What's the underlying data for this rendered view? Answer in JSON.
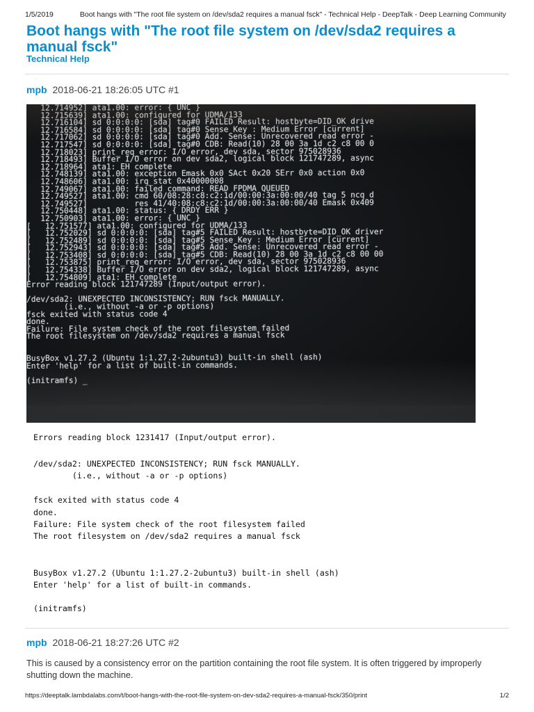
{
  "print_header": {
    "date": "1/5/2019",
    "page_title": "Boot hangs with \"The root file system on /dev/sda2 requires a manual fsck\" - Technical Help - DeepTalk - Deep Learning Community"
  },
  "topic": {
    "title": "Boot hangs with \"The root file system on /dev/sda2 requires a manual fsck\"",
    "category": "Technical Help"
  },
  "posts": [
    {
      "author": "mpb",
      "timestamp": "2018-06-21 18:26:05 UTC #1",
      "photo_console_lines": [
        "   12.714952] ata1.00: error: { UNC }",
        "   12.715639] ata1.00: configured for UDMA/133",
        "   12.716104] sd 0:0:0:0: [sda] tag#0 FAILED Result: hostbyte=DID_OK drive",
        "   12.716584] sd 0:0:0:0: [sda] tag#0 Sense Key : Medium Error [current]",
        "   12.717062] sd 0:0:0:0: [sda] tag#0 Add. Sense: Unrecovered read error -",
        "   12.717547] sd 0:0:0:0: [sda] tag#0 CDB: Read(10) 28 00 3a 1d c2 c8 00 0",
        "   12.718023] print_req_error: I/O error, dev sda, sector 975028936",
        "   12.718493] Buffer I/O error on dev sda2, logical block 121747289, async",
        "   12.718964] ata1: EH complete",
        "   12.748139] ata1.00: exception Emask 0x0 SAct 0x20 SErr 0x0 action 0x0",
        "   12.748606] ata1.00: irq_stat 0x40000008",
        "   12.749067] ata1.00: failed command: READ FPDMA QUEUED",
        "   12.749527] ata1.00: cmd 60/08:28:c8:c2:1d/00:00:3a:00:00/40 tag 5 ncq d",
        "   12.749527]          res 41/40:08:c8:c2:1d/00:00:3a:00:00/40 Emask 0x409",
        "   12.750448] ata1.00: status: { DRDY ERR }",
        "   12.750903] ata1.00: error: { UNC }",
        "[   12.751577] ata1.00: configured for UDMA/133",
        "[   12.752029] sd 0:0:0:0: [sda] tag#5 FAILED Result: hostbyte=DID_OK driver",
        "[   12.752489] sd 0:0:0:0: [sda] tag#5 Sense Key : Medium Error [current]",
        "[   12.752943] sd 0:0:0:0: [sda] tag#5 Add. Sense: Unrecovered read error -",
        "[   12.753408] sd 0:0:0:0: [sda] tag#5 CDB: Read(10) 28 00 3a 1d c2 c8 00 00",
        "[   12.753875] print_req_error: I/O error, dev sda, sector 975028936",
        "[   12.754338] Buffer I/O error on dev sda2, logical block 121747289, async",
        "[   12.754809] ata1: EH complete",
        "Error reading block 121747289 (Input/output error).",
        "",
        "/dev/sda2: UNEXPECTED INCONSISTENCY; RUN fsck MANUALLY.",
        "        (i.e., without -a or -p options)",
        "fsck exited with status code 4",
        "done.",
        "Failure: File system check of the root filesystem failed",
        "The root filesystem on /dev/sda2 requires a manual fsck",
        "",
        "",
        "BusyBox v1.27.2 (Ubuntu 1:1.27.2-2ubuntu3) built-in shell (ash)",
        "Enter 'help' for a list of built-in commands.",
        "",
        "(initramfs) _"
      ],
      "code_lines": [
        "Errors reading block 1231417 (Input/output error).",
        "/dev/sda2: UNEXPECTED INCONSISTENCY; RUN fsck MANUALLY.",
        "    (i.e., without -a or -p options)",
        "fsck exited with status code 4",
        "done.",
        "Failure: File system check of the root filesystem failed",
        "The root filesystem on /dev/sda2 requires a manual fsck",
        "BusyBox v1.27.2 (Ubuntu 1:1.27.2-2ubuntu3) built-in shell (ash)",
        "Enter 'help' for a list of built-in commands.",
        "(initramfs)"
      ]
    },
    {
      "author": "mpb",
      "timestamp": "2018-06-21 18:27:26 UTC #2",
      "body": "This is caused by a consistency error on the partition containing the root file system. It is often triggered by improperly shutting down the machine."
    }
  ],
  "print_footer": {
    "url": "https://deeptalk.lambdalabs.com/t/boot-hangs-with-the-root-file-system-on-dev-sda2-requires-a-manual-fsck/350/print",
    "page": "1/2"
  },
  "colors": {
    "link_blue": "#0a8ccf",
    "text": "#222222",
    "console_text": "#d4d7db",
    "console_bg": "#131517"
  }
}
